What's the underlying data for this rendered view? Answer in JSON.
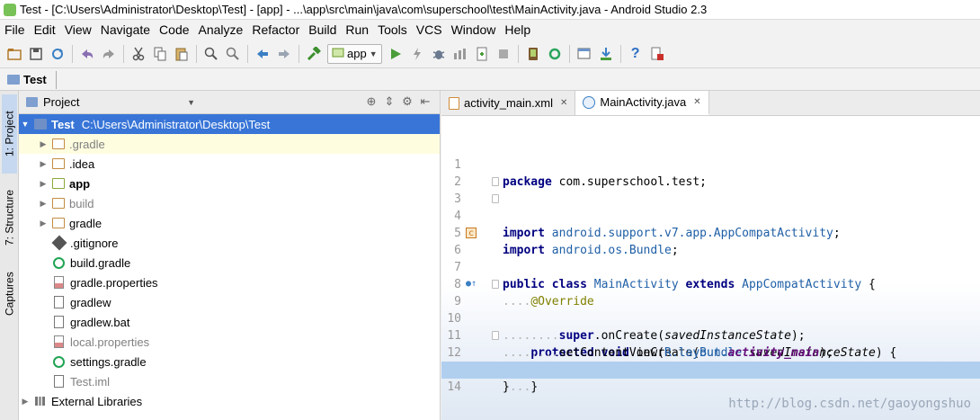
{
  "window": {
    "title": "Test - [C:\\Users\\Administrator\\Desktop\\Test] - [app] - ...\\app\\src\\main\\java\\com\\superschool\\test\\MainActivity.java - Android Studio 2.3"
  },
  "menu": [
    "File",
    "Edit",
    "View",
    "Navigate",
    "Code",
    "Analyze",
    "Refactor",
    "Build",
    "Run",
    "Tools",
    "VCS",
    "Window",
    "Help"
  ],
  "toolbar": {
    "run_config": "app"
  },
  "breadcrumb": {
    "project": "Test"
  },
  "side_tabs": {
    "project": "1: Project",
    "structure": "7: Structure",
    "captures": "Captures"
  },
  "project_panel": {
    "view_selector": "Project",
    "root": {
      "name": "Test",
      "path": "C:\\Users\\Administrator\\Desktop\\Test"
    },
    "items": [
      {
        "label": ".gradle"
      },
      {
        "label": ".idea"
      },
      {
        "label": "app"
      },
      {
        "label": "build"
      },
      {
        "label": "gradle"
      },
      {
        "label": ".gitignore"
      },
      {
        "label": "build.gradle"
      },
      {
        "label": "gradle.properties"
      },
      {
        "label": "gradlew"
      },
      {
        "label": "gradlew.bat"
      },
      {
        "label": "local.properties"
      },
      {
        "label": "settings.gradle"
      },
      {
        "label": "Test.iml"
      },
      {
        "label": "External Libraries"
      }
    ]
  },
  "editor": {
    "tabs": [
      {
        "label": "activity_main.xml"
      },
      {
        "label": "MainActivity.java"
      }
    ],
    "line_numbers": [
      "1",
      "2",
      "3",
      "4",
      "5",
      "6",
      "7",
      "8",
      "9",
      "10",
      "11",
      "12",
      "13",
      "14"
    ],
    "code": {
      "l1_kw": "package",
      "l1_rest": " com.superschool.test;",
      "l3_kw": "import",
      "l3_rest": " android.support.v7.app.AppCompatActivity",
      "l3_end": ";",
      "l4_kw": "import",
      "l4_rest": " android.os.Bundle",
      "l4_end": ";",
      "l6_kw1": "public class",
      "l6_name": " MainActivity",
      "l6_kw2": " extends",
      "l6_type": " AppCompatActivity",
      "l6_end": " {",
      "l8_indent": "....",
      "l8_ann": "@Override",
      "l9_indent": "....",
      "l9_kw": "protected void",
      "l9_name": " onCreate(",
      "l9_type": "Bundle",
      "l9_param": " savedInstanceState",
      "l9_end": ") {",
      "l10_indent": "........",
      "l10_kw": "super",
      "l10_call": ".onCreate(",
      "l10_arg": "savedInstanceState",
      "l10_end": ");",
      "l11_indent": "........",
      "l11_call": "setContentView(",
      "l11_r": "R.layout.",
      "l11_field": "activity_main",
      "l11_end": ");",
      "l12_indent": "....",
      "l12_end": "}",
      "l13_end": "}"
    }
  },
  "watermark": "http://blog.csdn.net/gaoyongshuo"
}
